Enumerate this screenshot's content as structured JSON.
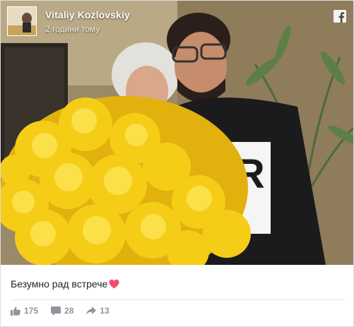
{
  "post": {
    "author": "Vitaliy Kozlovskiy",
    "timestamp": "2 години тому",
    "caption": "Безумно рад встрече",
    "caption_emoji": "heart-icon",
    "platform_icon": "facebook-icon"
  },
  "actions": {
    "likes": "175",
    "comments": "28",
    "shares": "13"
  },
  "colors": {
    "meta_gray": "#90949c",
    "text": "#1d2129",
    "heart": "#f0506e",
    "divider": "#e5e6e9"
  }
}
